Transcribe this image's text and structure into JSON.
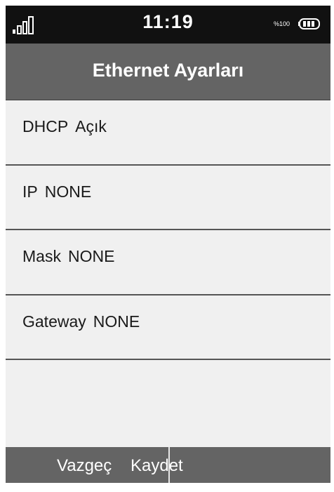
{
  "status_bar": {
    "time": "11:19",
    "battery_percent": "%100",
    "signal_icon": "signal-bars-icon",
    "battery_icon": "battery-full-icon"
  },
  "header": {
    "title": "Ethernet Ayarları"
  },
  "settings": [
    {
      "label": "DHCP",
      "value": "Açık"
    },
    {
      "label": "IP",
      "value": "NONE"
    },
    {
      "label": "Mask",
      "value": "NONE"
    },
    {
      "label": "Gateway",
      "value": "NONE"
    }
  ],
  "footer": {
    "cancel_label": "Vazgeç",
    "save_label": "Kaydet"
  },
  "colors": {
    "status_bar_bg": "#111111",
    "header_bg": "#646464",
    "content_bg": "#f0f0f0",
    "divider": "#555555"
  }
}
